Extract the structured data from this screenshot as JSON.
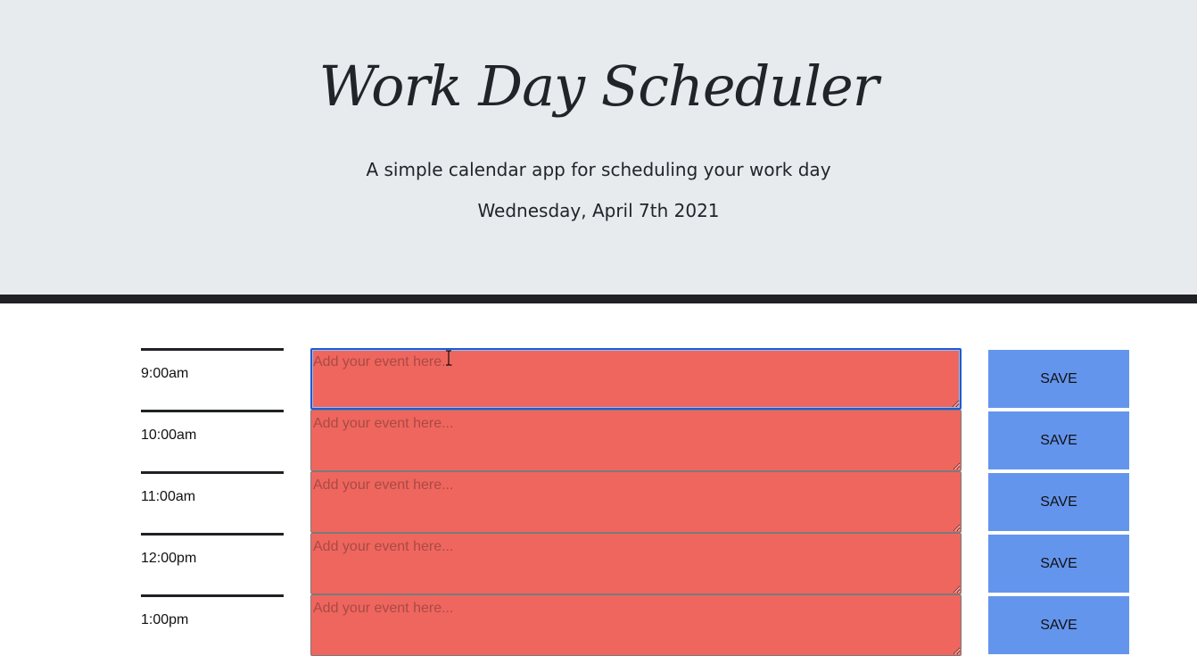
{
  "header": {
    "title": "Work Day Scheduler",
    "subtitle": "A simple calendar app for scheduling your work day",
    "current_day": "Wednesday, April 7th 2021"
  },
  "rows": [
    {
      "hour": "9:00am",
      "placeholder": "Add your event here...",
      "value": "",
      "save_label": "SAVE",
      "status": "past",
      "focused": true
    },
    {
      "hour": "10:00am",
      "placeholder": "Add your event here...",
      "value": "",
      "save_label": "SAVE",
      "status": "past"
    },
    {
      "hour": "11:00am",
      "placeholder": "Add your event here...",
      "value": "",
      "save_label": "SAVE",
      "status": "past"
    },
    {
      "hour": "12:00pm",
      "placeholder": "Add your event here...",
      "value": "",
      "save_label": "SAVE",
      "status": "past"
    },
    {
      "hour": "1:00pm",
      "placeholder": "Add your event here...",
      "value": "",
      "save_label": "SAVE",
      "status": "past"
    }
  ],
  "colors": {
    "past": "#ef665e",
    "save_button": "#6495ed",
    "header_bg": "#e8ebee"
  }
}
